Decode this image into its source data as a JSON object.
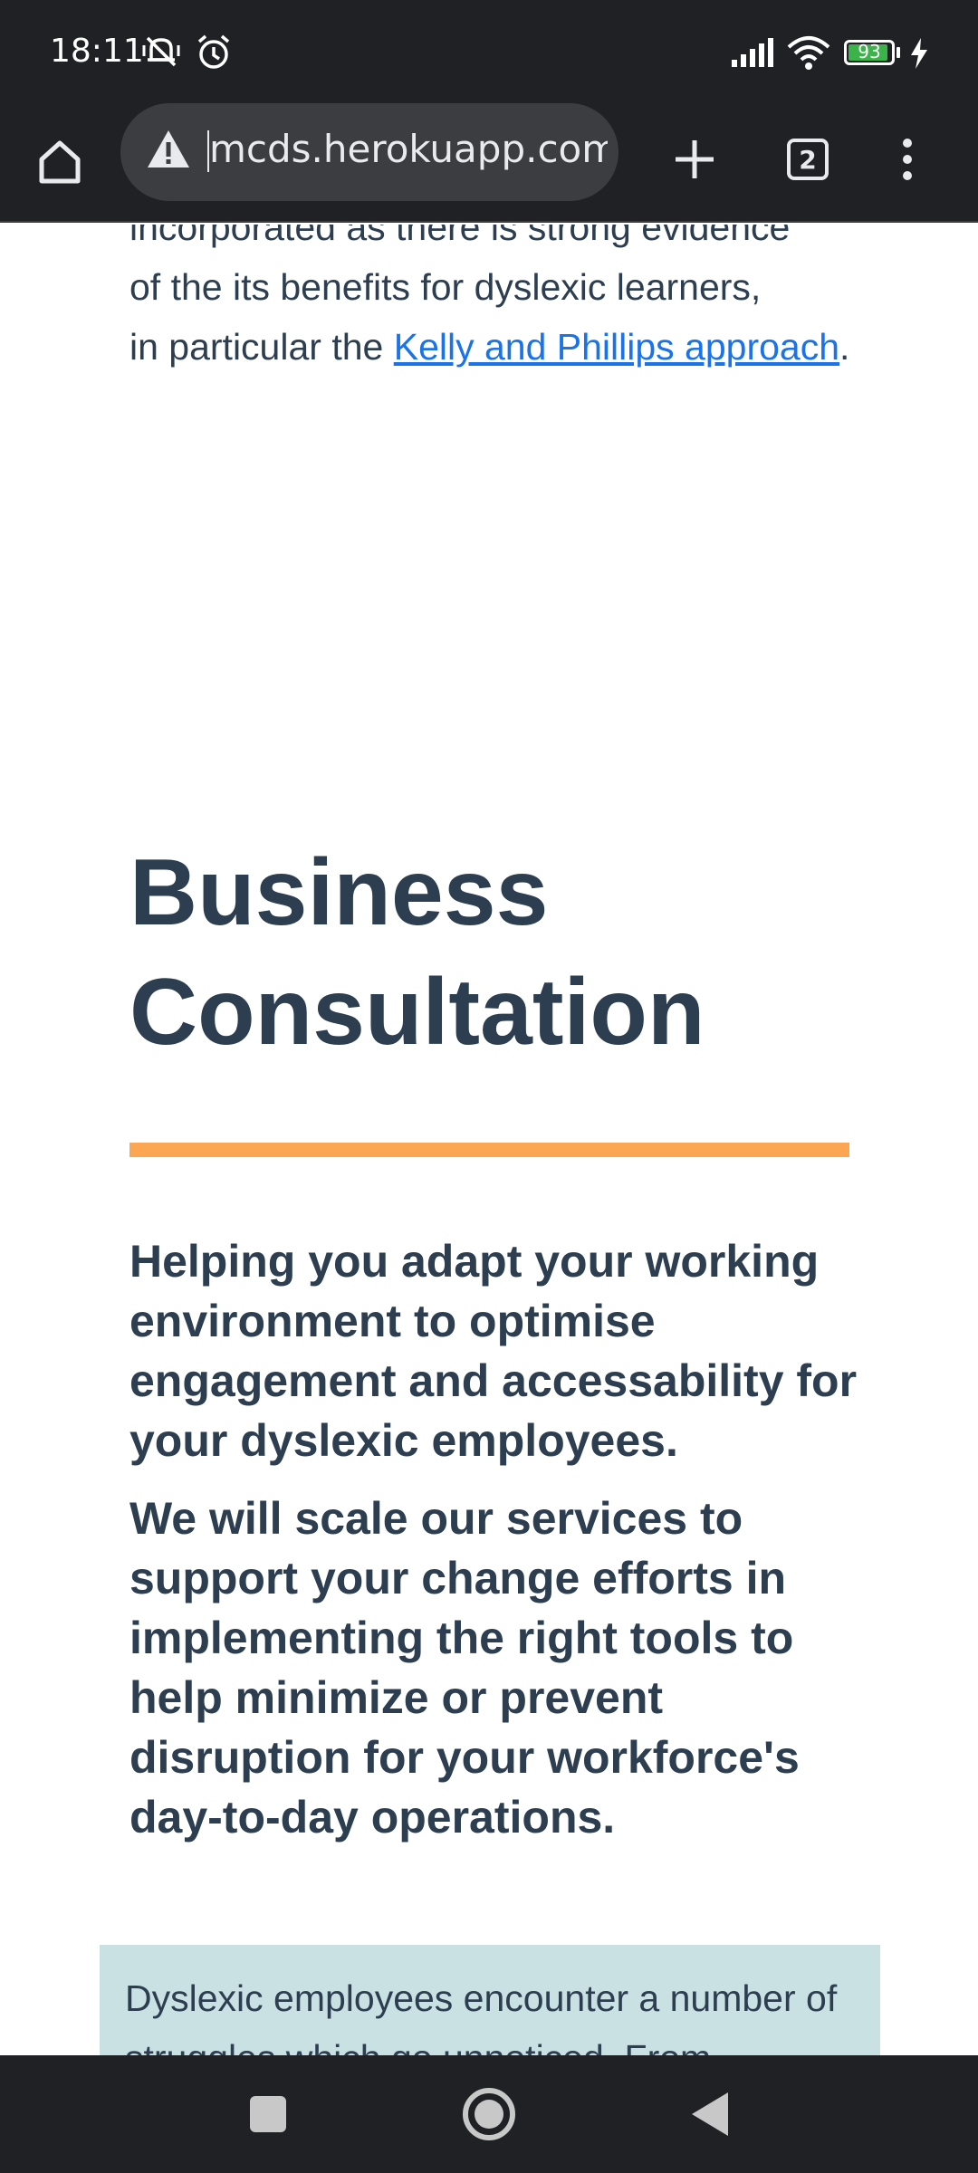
{
  "status_bar": {
    "time": "18:11",
    "battery_percent": 93,
    "battery_label": "93",
    "icons": [
      "notifications-muted-icon",
      "alarm-icon",
      "signal-icon",
      "wifi-icon",
      "battery-icon",
      "charging-icon"
    ]
  },
  "toolbar": {
    "url": "mcds.herokuapp.com",
    "tab_count": "2",
    "icons": [
      "home-icon",
      "warning-icon",
      "new-tab-icon",
      "tab-switcher-icon",
      "more-menu-icon"
    ]
  },
  "page": {
    "intro_line1": "incorporated as there is strong evidence",
    "intro_line2": "of the its benefits for dyslexic learners,",
    "intro_line3_prefix": "in particular the ",
    "intro_link": "Kelly and Phillips approach",
    "intro_suffix": ".",
    "section_title": "Business Consultation",
    "lead_1": "Helping you adapt your working environment to optimise engagement and accessability for your dyslexic employees.",
    "lead_2": "We will scale our services to support your change efforts in implementing the right tools to help minimize or prevent disruption for your workforce's day-to-day operations.",
    "callout_text": "Dyslexic employees encounter a number of struggles which go unnoticed. From",
    "colors": {
      "heading": "#2c3e50",
      "link": "#1a73e8",
      "rule": "#fca552",
      "callout_bg": "#cae1e4"
    }
  },
  "nav_bar": {
    "icons": [
      "recents-icon",
      "home-circle-icon",
      "back-icon"
    ]
  }
}
